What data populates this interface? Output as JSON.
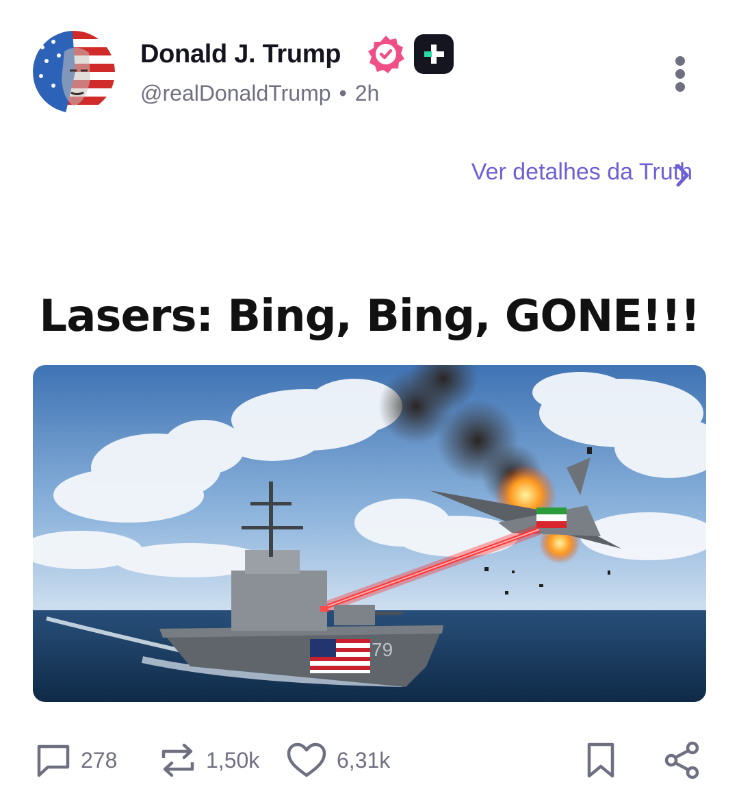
{
  "author": {
    "name": "Donald J. Trump",
    "handle": "@realDonaldTrump",
    "separator": "•",
    "time": "2h",
    "verified_color": "#f04e86",
    "plus_badge_accent": "#2bd9a4"
  },
  "header": {
    "more_icon": "more-vertical-icon"
  },
  "details_link": {
    "label": "Ver detalhes da Truth",
    "color": "#6d5fd6",
    "icon": "chevron-right-icon"
  },
  "post": {
    "title": "Lasers: Bing, Bing, GONE!!!",
    "image_subject": {
      "hull_number": "79"
    }
  },
  "actions": {
    "replies": {
      "icon": "comment-icon",
      "count": "278"
    },
    "retruths": {
      "icon": "repost-icon",
      "count": "1,50k"
    },
    "likes": {
      "icon": "heart-icon",
      "count": "6,31k"
    },
    "bookmark": {
      "icon": "bookmark-icon"
    },
    "share": {
      "icon": "share-icon"
    }
  },
  "colors": {
    "text_primary": "#14141e",
    "text_secondary": "#6f6f82",
    "icon": "#6f6f82"
  }
}
